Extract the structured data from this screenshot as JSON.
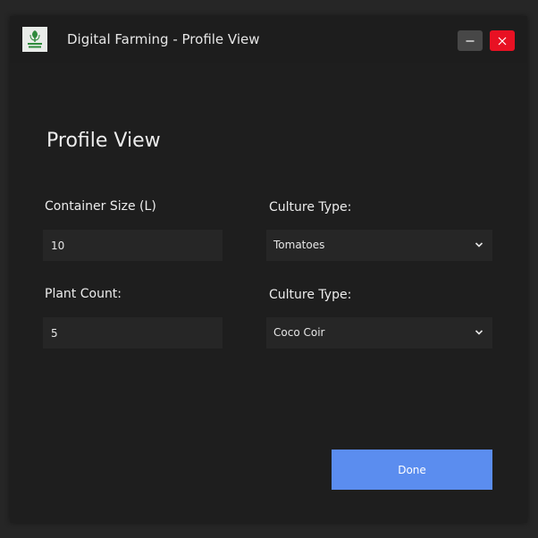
{
  "window": {
    "title": "Digital Farming - Profile View",
    "logo_text": "DIGITAL FARMING",
    "controls": {
      "minimize_icon": "minus-icon",
      "close_icon": "close-icon"
    }
  },
  "page": {
    "heading": "Profile View"
  },
  "form": {
    "container_size": {
      "label": "Container Size (L)",
      "value": "10"
    },
    "culture_type_1": {
      "label": "Culture Type:",
      "selected": "Tomatoes"
    },
    "plant_count": {
      "label": "Plant Count:",
      "value": "5"
    },
    "culture_type_2": {
      "label": "Culture Type:",
      "selected": "Coco Coir"
    }
  },
  "actions": {
    "done_label": "Done"
  },
  "colors": {
    "background": "#1e1e1e",
    "input_background": "#262626",
    "accent": "#5b8def",
    "close": "#e81123"
  }
}
